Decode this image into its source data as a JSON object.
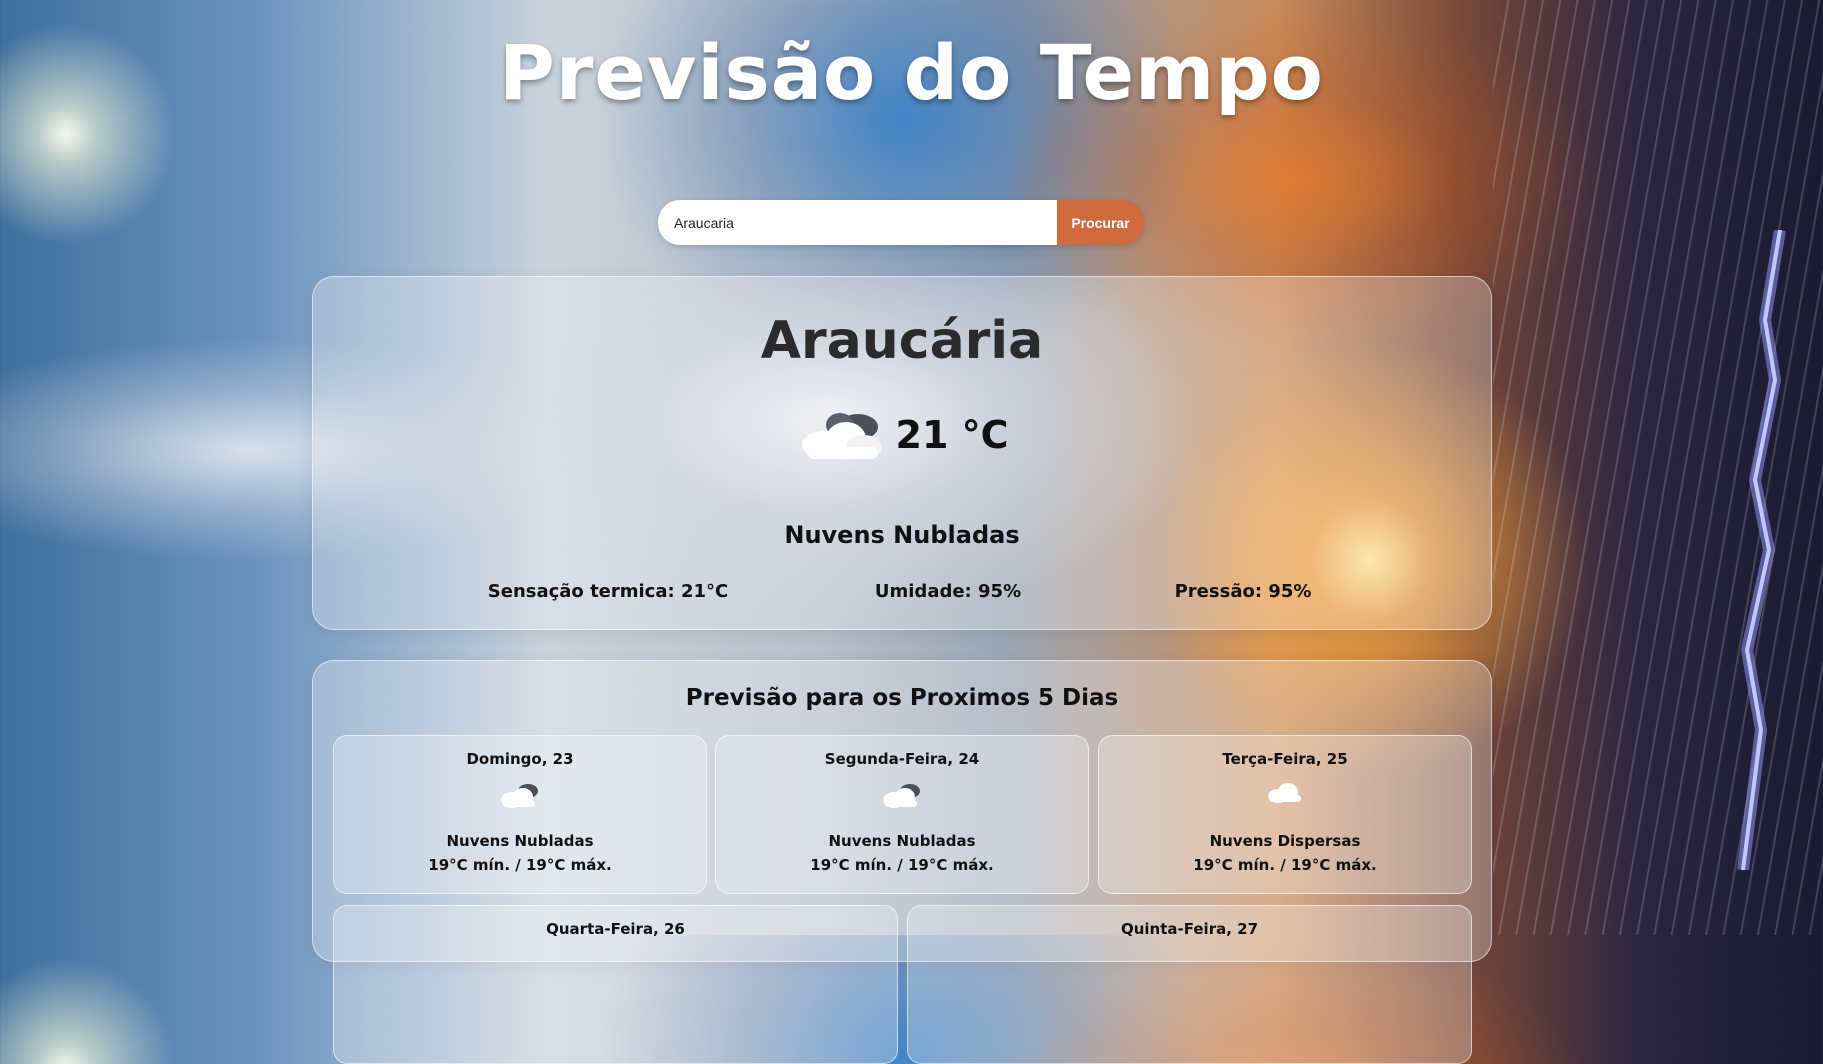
{
  "header": {
    "title": "Previsão do Tempo"
  },
  "search": {
    "value": "Araucaria",
    "button_label": "Procurar"
  },
  "current": {
    "city": "Araucária",
    "icon": "cloud-icon",
    "temperature": "21 °C",
    "description": "Nuvens Nubladas",
    "feels_like": "Sensação termica: 21°C",
    "humidity": "Umidade: 95%",
    "pressure": "Pressão: 95%"
  },
  "forecast": {
    "title": "Previsão para os Proximos 5 Dias",
    "days": [
      {
        "name": "Domingo, 23",
        "icon": "overcast-cloud-icon",
        "description": "Nuvens Nubladas",
        "range": "19°C mín. / 19°C máx."
      },
      {
        "name": "Segunda-Feira, 24",
        "icon": "overcast-cloud-icon",
        "description": "Nuvens Nubladas",
        "range": "19°C mín. / 19°C máx."
      },
      {
        "name": "Terça-Feira, 25",
        "icon": "cloud-icon",
        "description": "Nuvens Dispersas",
        "range": "19°C mín. / 19°C máx."
      },
      {
        "name": "Quarta-Feira, 26"
      },
      {
        "name": "Quinta-Feira, 27"
      }
    ]
  }
}
